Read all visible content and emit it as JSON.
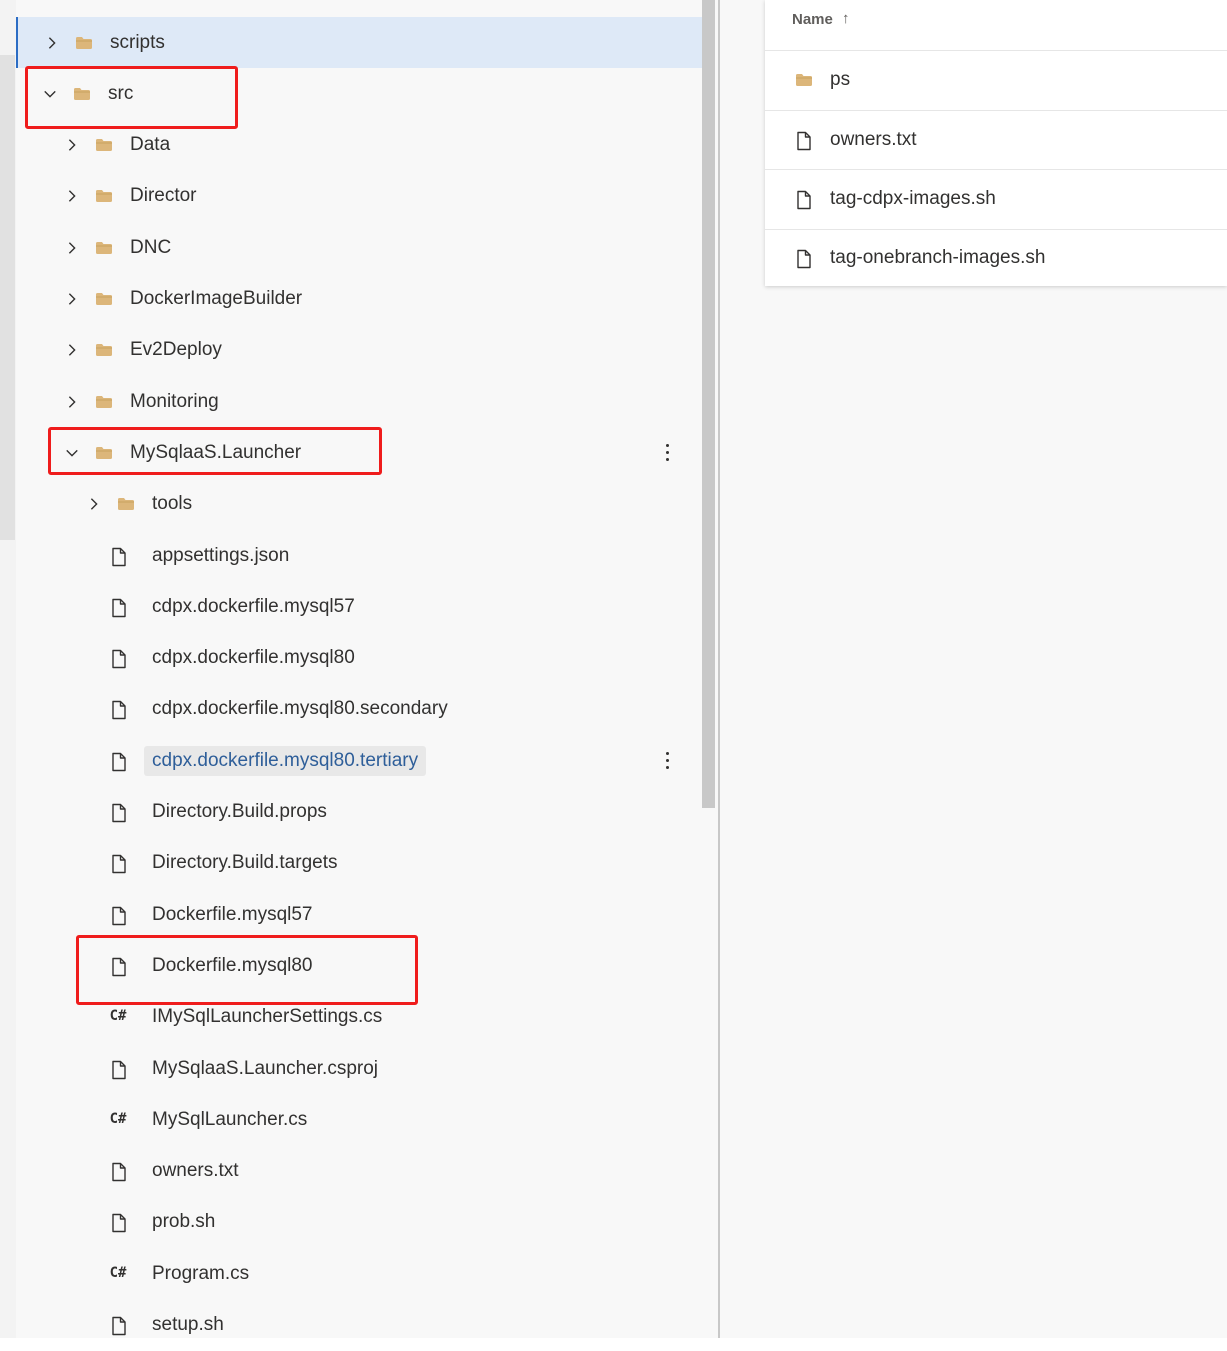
{
  "tree": {
    "items": [
      {
        "label": "scripts",
        "type": "folder",
        "chevron": "right",
        "selected": true
      },
      {
        "label": "src",
        "type": "folder",
        "chevron": "down"
      },
      {
        "label": "Data",
        "type": "folder",
        "chevron": "right"
      },
      {
        "label": "Director",
        "type": "folder",
        "chevron": "right"
      },
      {
        "label": "DNC",
        "type": "folder",
        "chevron": "right"
      },
      {
        "label": "DockerImageBuilder",
        "type": "folder",
        "chevron": "right"
      },
      {
        "label": "Ev2Deploy",
        "type": "folder",
        "chevron": "right"
      },
      {
        "label": "Monitoring",
        "type": "folder",
        "chevron": "right"
      },
      {
        "label": "MySqlaaS.Launcher",
        "type": "folder",
        "chevron": "down",
        "more": true
      },
      {
        "label": "tools",
        "type": "folder",
        "chevron": "right"
      },
      {
        "label": "appsettings.json",
        "type": "file"
      },
      {
        "label": "cdpx.dockerfile.mysql57",
        "type": "file"
      },
      {
        "label": "cdpx.dockerfile.mysql80",
        "type": "file"
      },
      {
        "label": "cdpx.dockerfile.mysql80.secondary",
        "type": "file"
      },
      {
        "label": "cdpx.dockerfile.mysql80.tertiary",
        "type": "file",
        "highlighted": true,
        "more": true
      },
      {
        "label": "Directory.Build.props",
        "type": "file"
      },
      {
        "label": "Directory.Build.targets",
        "type": "file"
      },
      {
        "label": "Dockerfile.mysql57",
        "type": "file"
      },
      {
        "label": "Dockerfile.mysql80",
        "type": "file"
      },
      {
        "label": "IMySqlLauncherSettings.cs",
        "type": "csharp"
      },
      {
        "label": "MySqlaaS.Launcher.csproj",
        "type": "file"
      },
      {
        "label": "MySqlLauncher.cs",
        "type": "csharp"
      },
      {
        "label": "owners.txt",
        "type": "file"
      },
      {
        "label": "prob.sh",
        "type": "file"
      },
      {
        "label": "Program.cs",
        "type": "csharp"
      },
      {
        "label": "setup.sh",
        "type": "file"
      }
    ]
  },
  "csharp_badge": "C#",
  "file_list": {
    "header": "Name",
    "sort_arrow": "↑",
    "items": [
      {
        "label": "ps",
        "type": "folder"
      },
      {
        "label": "owners.txt",
        "type": "file"
      },
      {
        "label": "tag-cdpx-images.sh",
        "type": "file"
      },
      {
        "label": "tag-onebranch-images.sh",
        "type": "file"
      }
    ]
  },
  "colors": {
    "folder": "#dcb67a",
    "selection": "#dee9f7",
    "selection_border": "#2b6cc4",
    "highlight_text": "#2e5e99",
    "annotation_red": "#ef1c1c"
  },
  "icons": {
    "folder": "folder-icon",
    "file": "file-icon",
    "csharp": "csharp-file-icon",
    "chevron_right": "chevron-right-icon",
    "chevron_down": "chevron-down-icon",
    "more": "more-vertical-icon"
  }
}
